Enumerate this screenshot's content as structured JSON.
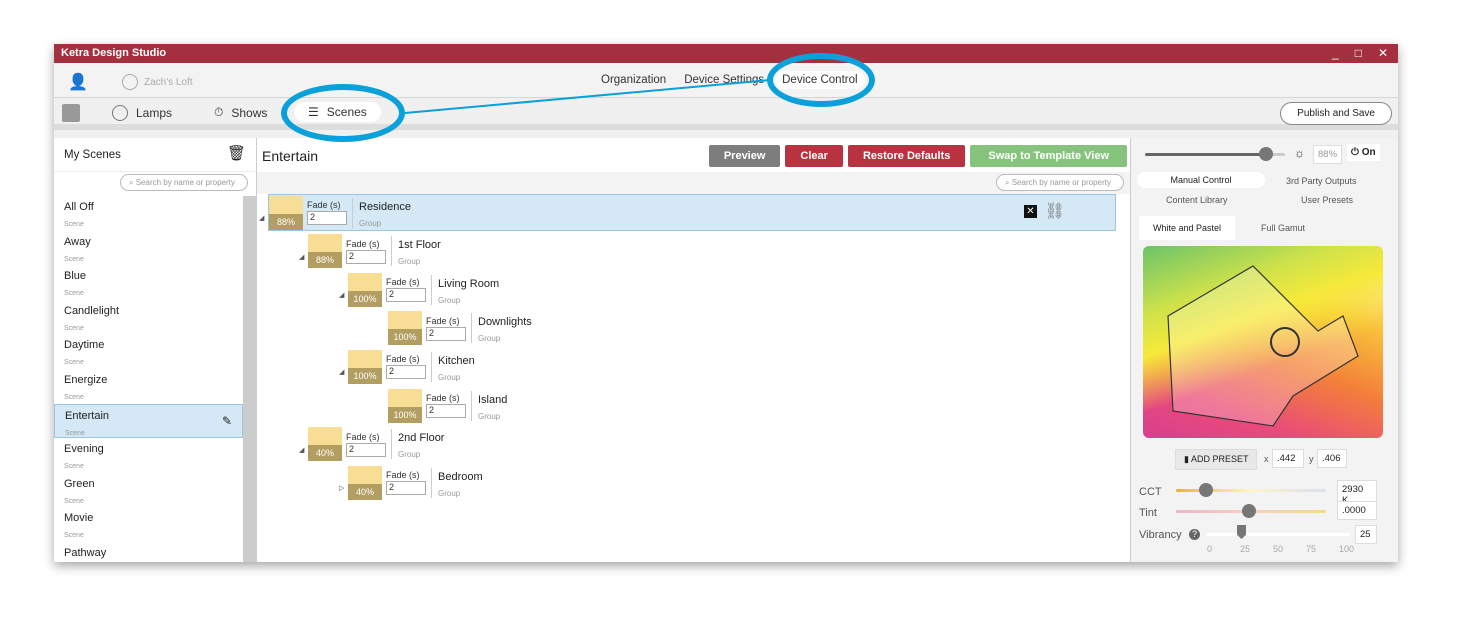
{
  "window": {
    "title": "Ketra Design Studio",
    "controls": [
      "_",
      "□",
      "✕"
    ]
  },
  "nav": {
    "installation": "Zach's Loft",
    "tabs": [
      "Organization",
      "Device Settings",
      "Device Control"
    ],
    "selected": "Device Control"
  },
  "toolbar": {
    "items": [
      "Lamps",
      "Shows",
      "Scenes"
    ],
    "selected": "Scenes",
    "publish": "Publish and Save"
  },
  "sidebar": {
    "title": "My Scenes",
    "search_placeholder": "Search by name or property",
    "items": [
      {
        "name": "All Off",
        "type": "Scene"
      },
      {
        "name": "Away",
        "type": "Scene"
      },
      {
        "name": "Blue",
        "type": "Scene"
      },
      {
        "name": "Candlelight",
        "type": "Scene"
      },
      {
        "name": "Daytime",
        "type": "Scene"
      },
      {
        "name": "Energize",
        "type": "Scene"
      },
      {
        "name": "Entertain",
        "type": "Scene"
      },
      {
        "name": "Evening",
        "type": "Scene"
      },
      {
        "name": "Green",
        "type": "Scene"
      },
      {
        "name": "Movie",
        "type": "Scene"
      },
      {
        "name": "Pathway",
        "type": "Scene"
      }
    ],
    "selected": "Entertain"
  },
  "main": {
    "title": "Entertain",
    "buttons": {
      "preview": "Preview",
      "clear": "Clear",
      "restore": "Restore Defaults",
      "swap": "Swap to Template View"
    },
    "search_placeholder": "Search by name or property",
    "fade_label": "Fade (s)",
    "tree": [
      {
        "name": "Residence",
        "type": "Group",
        "level": 88,
        "level_text": "88%",
        "fade": "2",
        "depth": 0
      },
      {
        "name": "1st Floor",
        "type": "Group",
        "level": 88,
        "level_text": "88%",
        "fade": "2",
        "depth": 1
      },
      {
        "name": "Living Room",
        "type": "Group",
        "level": 100,
        "level_text": "100%",
        "fade": "2",
        "depth": 2
      },
      {
        "name": "Downlights",
        "type": "Group",
        "level": 100,
        "level_text": "100%",
        "fade": "2",
        "depth": 3
      },
      {
        "name": "Kitchen",
        "type": "Group",
        "level": 100,
        "level_text": "100%",
        "fade": "2",
        "depth": 2
      },
      {
        "name": "Island",
        "type": "Group",
        "level": 100,
        "level_text": "100%",
        "fade": "2",
        "depth": 3
      },
      {
        "name": "2nd Floor",
        "type": "Group",
        "level": 40,
        "level_text": "40%",
        "fade": "2",
        "depth": 1
      },
      {
        "name": "Bedroom",
        "type": "Group",
        "level": 40,
        "level_text": "40%",
        "fade": "2",
        "depth": 2
      }
    ]
  },
  "right": {
    "brightness": 88,
    "brightness_text": "88%",
    "power": "On",
    "tabs": [
      "Manual Control",
      "3rd Party Outputs",
      "Content Library",
      "User Presets"
    ],
    "selected_tab": "Manual Control",
    "gamut_tabs": [
      "White and Pastel",
      "Full Gamut"
    ],
    "selected_gamut": "White and Pastel",
    "add_preset": "ADD PRESET",
    "x_label": "x",
    "x": ".442",
    "y_label": "y",
    "y": ".406",
    "cct_label": "CCT",
    "cct": "2930 K",
    "tint_label": "Tint",
    "tint": ".0000",
    "vibrancy_label": "Vibrancy",
    "vibrancy": "25",
    "vibrancy_ticks": [
      "0",
      "25",
      "50",
      "75",
      "100"
    ]
  },
  "colors": {
    "titlebar": "#a4303f",
    "annotation": "#0aa0d9",
    "preview": "#7d7d7d",
    "clear": "#b9323f",
    "swap": "#86c47d"
  }
}
